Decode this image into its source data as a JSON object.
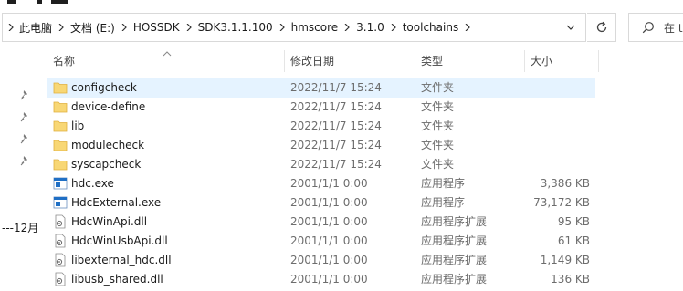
{
  "breadcrumb": [
    {
      "label": "此电脑"
    },
    {
      "label": "文档 (E:)"
    },
    {
      "label": "HOSSDK"
    },
    {
      "label": "SDK3.1.1.100"
    },
    {
      "label": "hmscore"
    },
    {
      "label": "3.1.0"
    },
    {
      "label": "toolchains"
    }
  ],
  "search": {
    "placeholder": "在 t"
  },
  "left_pane": {
    "partial_text": "---12月"
  },
  "columns": {
    "name": "名称",
    "modified": "修改日期",
    "type": "类型",
    "size": "大小"
  },
  "files": [
    {
      "name": "configcheck",
      "modified": "2022/11/7 15:24",
      "type": "文件夹",
      "size": "",
      "icon": "folder-icon",
      "selected": true
    },
    {
      "name": "device-define",
      "modified": "2022/11/7 15:24",
      "type": "文件夹",
      "size": "",
      "icon": "folder-icon"
    },
    {
      "name": "lib",
      "modified": "2022/11/7 15:24",
      "type": "文件夹",
      "size": "",
      "icon": "folder-icon"
    },
    {
      "name": "modulecheck",
      "modified": "2022/11/7 15:24",
      "type": "文件夹",
      "size": "",
      "icon": "folder-icon"
    },
    {
      "name": "syscapcheck",
      "modified": "2022/11/7 15:24",
      "type": "文件夹",
      "size": "",
      "icon": "folder-icon"
    },
    {
      "name": "hdc.exe",
      "modified": "2001/1/1 0:00",
      "type": "应用程序",
      "size": "3,386 KB",
      "icon": "exe-icon"
    },
    {
      "name": "HdcExternal.exe",
      "modified": "2001/1/1 0:00",
      "type": "应用程序",
      "size": "73,172 KB",
      "icon": "exe-icon"
    },
    {
      "name": "HdcWinApi.dll",
      "modified": "2001/1/1 0:00",
      "type": "应用程序扩展",
      "size": "95 KB",
      "icon": "dll-icon"
    },
    {
      "name": "HdcWinUsbApi.dll",
      "modified": "2001/1/1 0:00",
      "type": "应用程序扩展",
      "size": "61 KB",
      "icon": "dll-icon"
    },
    {
      "name": "libexternal_hdc.dll",
      "modified": "2001/1/1 0:00",
      "type": "应用程序扩展",
      "size": "1,149 KB",
      "icon": "dll-icon"
    },
    {
      "name": "libusb_shared.dll",
      "modified": "2001/1/1 0:00",
      "type": "应用程序扩展",
      "size": "136 KB",
      "icon": "dll-icon"
    }
  ],
  "colors": {
    "selection": "#e5f3ff",
    "folder": "#f8d775",
    "exe_blue": "#1f6fc5"
  }
}
